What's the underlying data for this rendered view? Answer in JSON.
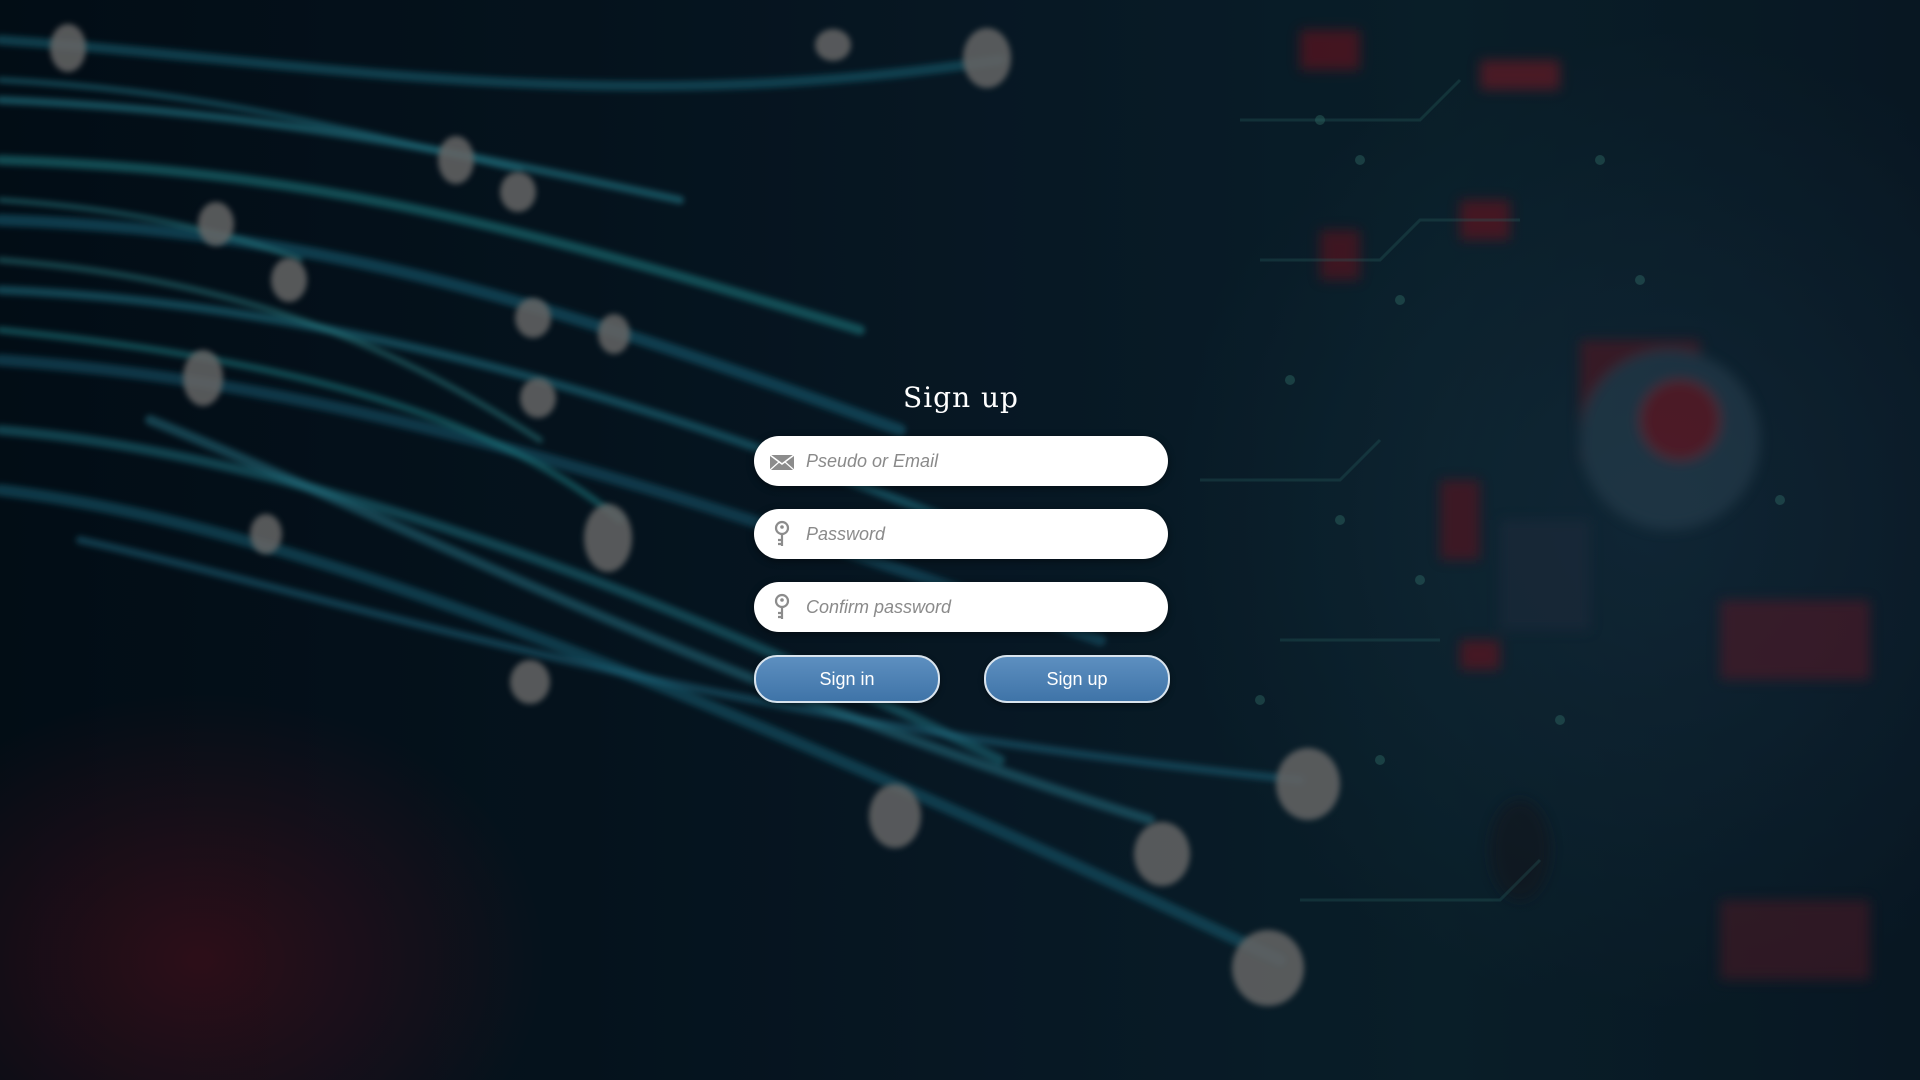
{
  "form": {
    "title": "Sign up",
    "fields": [
      {
        "icon": "envelope-icon",
        "placeholder": "Pseudo or Email",
        "value": ""
      },
      {
        "icon": "key-icon",
        "placeholder": "Password",
        "value": ""
      },
      {
        "icon": "key-icon",
        "placeholder": "Confirm password",
        "value": ""
      }
    ],
    "buttons": {
      "sign_in_label": "Sign in",
      "sign_up_label": "Sign up"
    }
  },
  "colors": {
    "button_fill": "#4a7fb3",
    "field_fill": "#ffffff",
    "title": "#ffffff"
  }
}
